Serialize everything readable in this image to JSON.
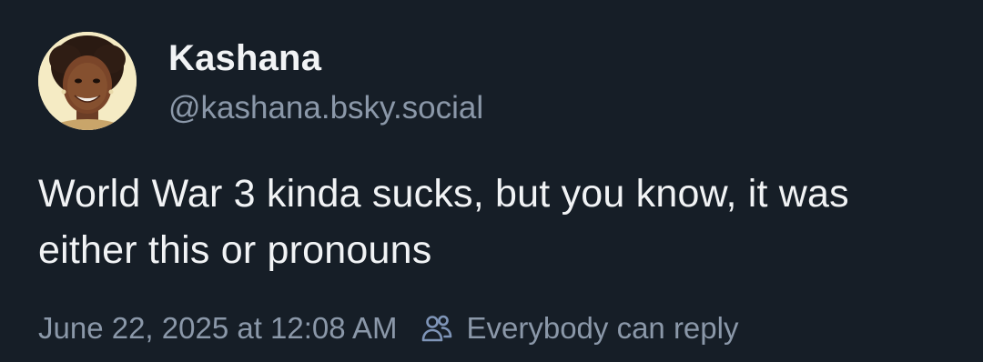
{
  "post": {
    "author": {
      "display_name": "Kashana",
      "handle": "@kashana.bsky.social",
      "avatar": "profile-photo"
    },
    "text": "World War 3 kinda sucks, but you know, it was either this or pronouns",
    "timestamp": "June 22, 2025 at 12:08 AM",
    "reply_setting": {
      "icon": "people-icon",
      "label": "Everybody can reply"
    }
  },
  "colors": {
    "background": "#161e27",
    "primary_text": "#f1f3f5",
    "secondary_text": "#8b98a9",
    "icon_accent": "#7f95b8"
  }
}
